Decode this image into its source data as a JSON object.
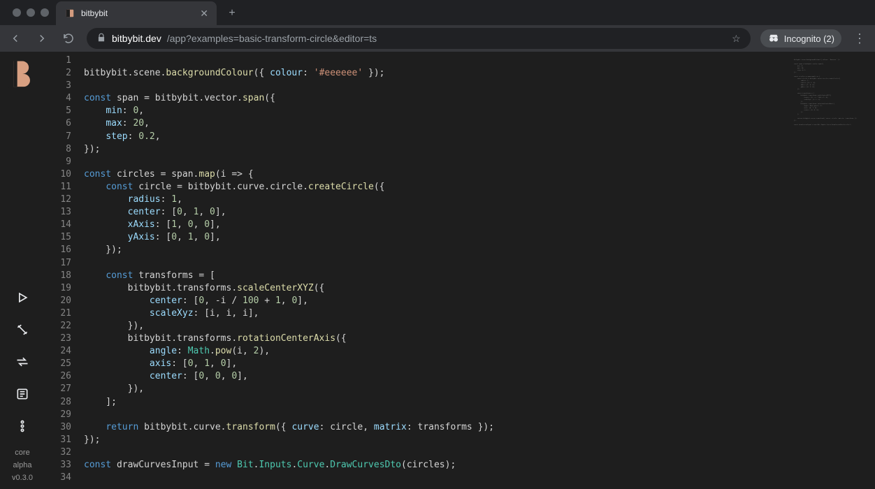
{
  "browser": {
    "tab_title": "bitbybit",
    "url_host": "bitbybit.dev",
    "url_path": "/app?examples=basic-transform-circle&editor=ts",
    "incognito_label": "Incognito (2)"
  },
  "sidebar": {
    "labels": {
      "core": "core",
      "alpha": "alpha",
      "version": "v0.3.0"
    }
  },
  "editor": {
    "lines": [
      {
        "n": 1,
        "seg": []
      },
      {
        "n": 2,
        "seg": [
          [
            "",
            "bitbybit.scene."
          ],
          [
            "fn",
            "backgroundColour"
          ],
          [
            "",
            "({ "
          ],
          [
            "prop",
            "colour"
          ],
          [
            "",
            ": "
          ],
          [
            "str",
            "'#eeeeee'"
          ],
          [
            "",
            " });"
          ]
        ]
      },
      {
        "n": 3,
        "seg": []
      },
      {
        "n": 4,
        "seg": [
          [
            "kw",
            "const"
          ],
          [
            "",
            " span = bitbybit.vector."
          ],
          [
            "fn",
            "span"
          ],
          [
            "",
            "({"
          ]
        ]
      },
      {
        "n": 5,
        "seg": [
          [
            "",
            "    "
          ],
          [
            "prop",
            "min"
          ],
          [
            "",
            ": "
          ],
          [
            "num",
            "0"
          ],
          [
            "",
            ","
          ]
        ]
      },
      {
        "n": 6,
        "seg": [
          [
            "",
            "    "
          ],
          [
            "prop",
            "max"
          ],
          [
            "",
            ": "
          ],
          [
            "num",
            "20"
          ],
          [
            "",
            ","
          ]
        ]
      },
      {
        "n": 7,
        "seg": [
          [
            "",
            "    "
          ],
          [
            "prop",
            "step"
          ],
          [
            "",
            ": "
          ],
          [
            "num",
            "0.2"
          ],
          [
            "",
            ","
          ]
        ]
      },
      {
        "n": 8,
        "seg": [
          [
            "",
            "});"
          ]
        ]
      },
      {
        "n": 9,
        "seg": []
      },
      {
        "n": 10,
        "seg": [
          [
            "kw",
            "const"
          ],
          [
            "",
            " circles = span."
          ],
          [
            "fn",
            "map"
          ],
          [
            "",
            "(i => {"
          ]
        ]
      },
      {
        "n": 11,
        "seg": [
          [
            "",
            "    "
          ],
          [
            "kw",
            "const"
          ],
          [
            "",
            " circle = bitbybit.curve.circle."
          ],
          [
            "fn",
            "createCircle"
          ],
          [
            "",
            "({"
          ]
        ]
      },
      {
        "n": 12,
        "seg": [
          [
            "",
            "        "
          ],
          [
            "prop",
            "radius"
          ],
          [
            "",
            ": "
          ],
          [
            "num",
            "1"
          ],
          [
            "",
            ","
          ]
        ]
      },
      {
        "n": 13,
        "seg": [
          [
            "",
            "        "
          ],
          [
            "prop",
            "center"
          ],
          [
            "",
            ": ["
          ],
          [
            "num",
            "0"
          ],
          [
            "",
            ", "
          ],
          [
            "num",
            "1"
          ],
          [
            "",
            ", "
          ],
          [
            "num",
            "0"
          ],
          [
            "",
            "],"
          ]
        ]
      },
      {
        "n": 14,
        "seg": [
          [
            "",
            "        "
          ],
          [
            "prop",
            "xAxis"
          ],
          [
            "",
            ": ["
          ],
          [
            "num",
            "1"
          ],
          [
            "",
            ", "
          ],
          [
            "num",
            "0"
          ],
          [
            "",
            ", "
          ],
          [
            "num",
            "0"
          ],
          [
            "",
            "],"
          ]
        ]
      },
      {
        "n": 15,
        "seg": [
          [
            "",
            "        "
          ],
          [
            "prop",
            "yAxis"
          ],
          [
            "",
            ": ["
          ],
          [
            "num",
            "0"
          ],
          [
            "",
            ", "
          ],
          [
            "num",
            "1"
          ],
          [
            "",
            ", "
          ],
          [
            "num",
            "0"
          ],
          [
            "",
            "],"
          ]
        ]
      },
      {
        "n": 16,
        "seg": [
          [
            "",
            "    });"
          ]
        ]
      },
      {
        "n": 17,
        "seg": []
      },
      {
        "n": 18,
        "seg": [
          [
            "",
            "    "
          ],
          [
            "kw",
            "const"
          ],
          [
            "",
            " transforms = ["
          ]
        ]
      },
      {
        "n": 19,
        "seg": [
          [
            "",
            "        bitbybit.transforms."
          ],
          [
            "fn",
            "scaleCenterXYZ"
          ],
          [
            "",
            "({"
          ]
        ]
      },
      {
        "n": 20,
        "seg": [
          [
            "",
            "            "
          ],
          [
            "prop",
            "center"
          ],
          [
            "",
            ": ["
          ],
          [
            "num",
            "0"
          ],
          [
            "",
            ", -i / "
          ],
          [
            "num",
            "100"
          ],
          [
            "",
            " + "
          ],
          [
            "num",
            "1"
          ],
          [
            "",
            ", "
          ],
          [
            "num",
            "0"
          ],
          [
            "",
            "],"
          ]
        ]
      },
      {
        "n": 21,
        "seg": [
          [
            "",
            "            "
          ],
          [
            "prop",
            "scaleXyz"
          ],
          [
            "",
            ": [i, i, i],"
          ]
        ]
      },
      {
        "n": 22,
        "seg": [
          [
            "",
            "        }),"
          ]
        ]
      },
      {
        "n": 23,
        "seg": [
          [
            "",
            "        bitbybit.transforms."
          ],
          [
            "fn",
            "rotationCenterAxis"
          ],
          [
            "",
            "({"
          ]
        ]
      },
      {
        "n": 24,
        "seg": [
          [
            "",
            "            "
          ],
          [
            "prop",
            "angle"
          ],
          [
            "",
            ": "
          ],
          [
            "type",
            "Math"
          ],
          [
            "",
            "."
          ],
          [
            "fn",
            "pow"
          ],
          [
            "",
            "(i, "
          ],
          [
            "num",
            "2"
          ],
          [
            "",
            "),"
          ]
        ]
      },
      {
        "n": 25,
        "seg": [
          [
            "",
            "            "
          ],
          [
            "prop",
            "axis"
          ],
          [
            "",
            ": ["
          ],
          [
            "num",
            "0"
          ],
          [
            "",
            ", "
          ],
          [
            "num",
            "1"
          ],
          [
            "",
            ", "
          ],
          [
            "num",
            "0"
          ],
          [
            "",
            "],"
          ]
        ]
      },
      {
        "n": 26,
        "seg": [
          [
            "",
            "            "
          ],
          [
            "prop",
            "center"
          ],
          [
            "",
            ": ["
          ],
          [
            "num",
            "0"
          ],
          [
            "",
            ", "
          ],
          [
            "num",
            "0"
          ],
          [
            "",
            ", "
          ],
          [
            "num",
            "0"
          ],
          [
            "",
            "],"
          ]
        ]
      },
      {
        "n": 27,
        "seg": [
          [
            "",
            "        }),"
          ]
        ]
      },
      {
        "n": 28,
        "seg": [
          [
            "",
            "    ];"
          ]
        ]
      },
      {
        "n": 29,
        "seg": []
      },
      {
        "n": 30,
        "seg": [
          [
            "",
            "    "
          ],
          [
            "kw",
            "return"
          ],
          [
            "",
            " bitbybit.curve."
          ],
          [
            "fn",
            "transform"
          ],
          [
            "",
            "({ "
          ],
          [
            "prop",
            "curve"
          ],
          [
            "",
            ": circle, "
          ],
          [
            "prop",
            "matrix"
          ],
          [
            "",
            ": transforms });"
          ]
        ]
      },
      {
        "n": 31,
        "seg": [
          [
            "",
            "});"
          ]
        ]
      },
      {
        "n": 32,
        "seg": []
      },
      {
        "n": 33,
        "seg": [
          [
            "kw",
            "const"
          ],
          [
            "",
            " drawCurvesInput = "
          ],
          [
            "kw",
            "new"
          ],
          [
            "",
            " "
          ],
          [
            "type",
            "Bit"
          ],
          [
            "",
            "."
          ],
          [
            "type",
            "Inputs"
          ],
          [
            "",
            "."
          ],
          [
            "type",
            "Curve"
          ],
          [
            "",
            "."
          ],
          [
            "type",
            "DrawCurvesDto"
          ],
          [
            "",
            "(circles);"
          ]
        ]
      },
      {
        "n": 34,
        "seg": []
      }
    ]
  }
}
